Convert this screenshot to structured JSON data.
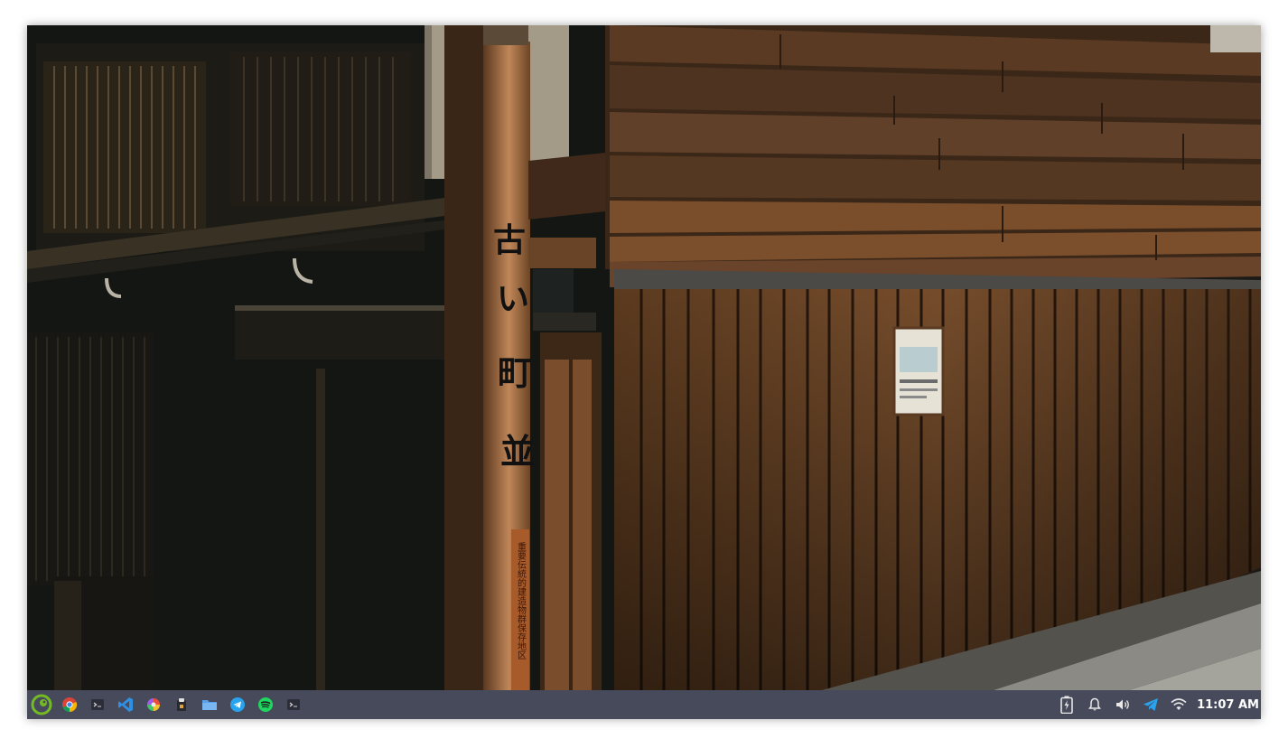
{
  "desktop": {
    "wallpaper": {
      "pillar_sign_chars": [
        "古",
        "い",
        "町",
        "並"
      ],
      "pillar_plaque_text": "重要伝統的建造物群保存地区"
    }
  },
  "taskbar": {
    "launcher_icon": "opensuse-gecko-icon",
    "apps": [
      {
        "icon": "chrome-icon"
      },
      {
        "icon": "terminal-icon"
      },
      {
        "icon": "vscode-icon"
      },
      {
        "icon": "color-picker-icon"
      },
      {
        "icon": "package-icon"
      },
      {
        "icon": "files-icon"
      },
      {
        "icon": "telegram-icon"
      },
      {
        "icon": "spotify-icon"
      },
      {
        "icon": "terminal-icon"
      }
    ],
    "tray": {
      "icons": [
        "battery-charging-icon",
        "notifications-icon",
        "volume-icon",
        "telegram-tray-icon",
        "wifi-icon"
      ],
      "clock": "11:07 AM"
    },
    "colors": {
      "background": "#474a5b",
      "accent_green": "#73ba25",
      "telegram_blue": "#2aa3ef",
      "vscode_blue": "#2f8fe5",
      "spotify_green": "#1ed760"
    }
  }
}
